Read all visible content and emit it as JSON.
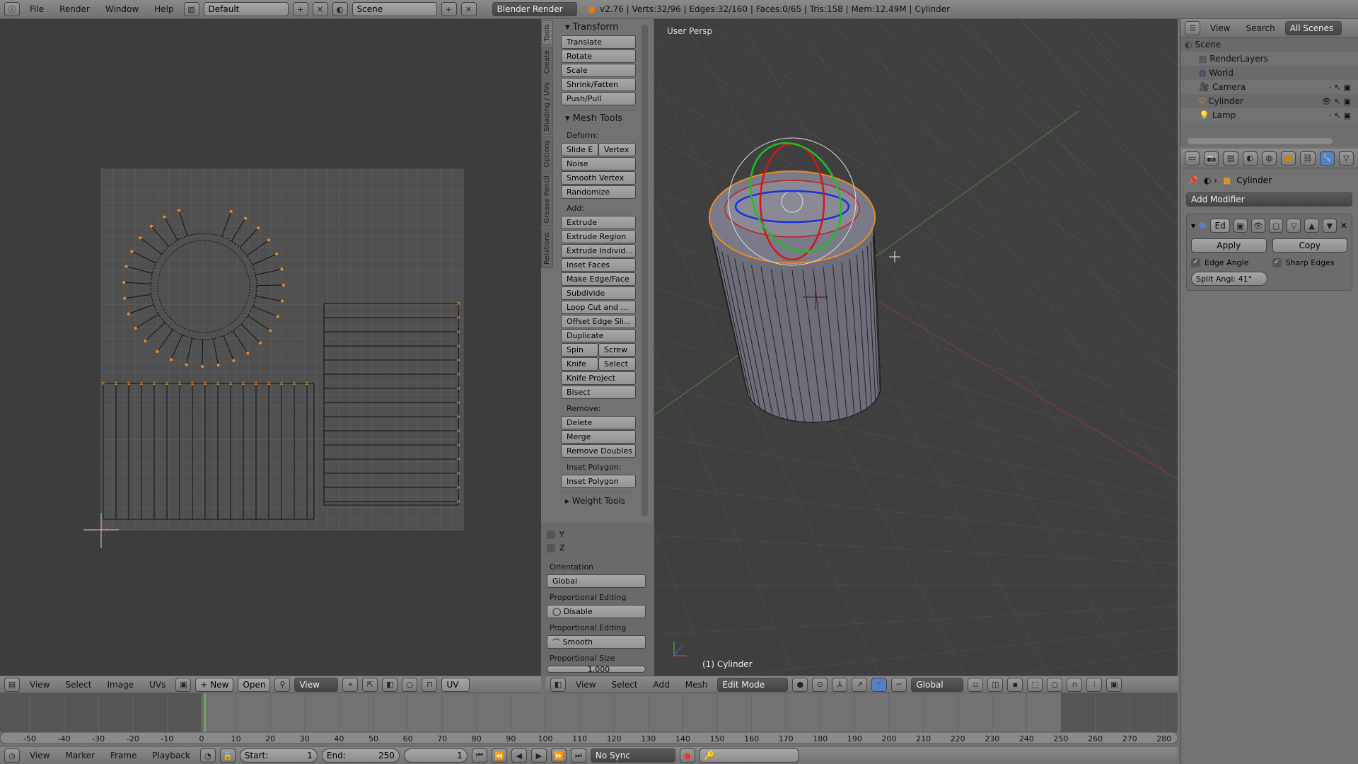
{
  "topbar": {
    "menus": [
      "File",
      "Render",
      "Window",
      "Help"
    ],
    "layout": "Default",
    "scene": "Scene",
    "engine": "Blender Render",
    "stats": "v2.76 | Verts:32/96 | Edges:32/160 | Faces:0/65 | Tris:158 | Mem:12.49M | Cylinder"
  },
  "uv_editor": {
    "header": {
      "menus": [
        "View",
        "Select",
        "Image",
        "UVs"
      ],
      "new": "New",
      "open": "Open",
      "view": "View",
      "uv": "UV"
    }
  },
  "toolshelf": {
    "tabs": [
      "Tools",
      "Create",
      "Shading / UVs",
      "Options",
      "Grease Pencil",
      "Relations"
    ],
    "transform": {
      "title": "Transform",
      "buttons": [
        "Translate",
        "Rotate",
        "Scale",
        "Shrink/Fatten",
        "Push/Pull"
      ]
    },
    "mesh_tools": {
      "title": "Mesh Tools",
      "deform_label": "Deform:",
      "slide": "Slide E",
      "vertex": "Vertex",
      "deform": [
        "Noise",
        "Smooth Vertex",
        "Randomize"
      ],
      "add_label": "Add:",
      "extrude": "Extrude",
      "add": [
        "Extrude Region",
        "Extrude Individ...",
        "Inset Faces",
        "Make Edge/Face",
        "Subdivide",
        "Loop Cut and ...",
        "Offset Edge Sli...",
        "Duplicate"
      ],
      "spin": "Spin",
      "screw": "Screw",
      "knife": "Knife",
      "select": "Select",
      "knife_project": "Knife Project",
      "bisect": "Bisect",
      "remove_label": "Remove:",
      "delete": "Delete",
      "merge": "Merge",
      "remove_doubles": "Remove Doubles",
      "inset_label": "Inset Polygon:",
      "inset": "Inset Polygon"
    },
    "weight_tools": "Weight Tools"
  },
  "operator": {
    "y": "Y",
    "z": "Z",
    "orientation_label": "Orientation",
    "orientation": "Global",
    "prop_label": "Proportional Editing",
    "prop": "Disable",
    "falloff_label": "Proportional Editing",
    "falloff": "Smooth",
    "size_label": "Proportional Size",
    "size": "1.000"
  },
  "viewport": {
    "title": "User Persp",
    "object": "(1) Cylinder",
    "header": {
      "menus": [
        "View",
        "Select",
        "Add",
        "Mesh"
      ],
      "mode": "Edit Mode",
      "orientation": "Global"
    }
  },
  "outliner": {
    "menus": [
      "View",
      "Search"
    ],
    "filter": "All Scenes",
    "items": [
      {
        "name": "Scene",
        "level": 0
      },
      {
        "name": "RenderLayers",
        "level": 1
      },
      {
        "name": "World",
        "level": 1
      },
      {
        "name": "Camera",
        "level": 1
      },
      {
        "name": "Cylinder",
        "level": 1
      },
      {
        "name": "Lamp",
        "level": 1
      }
    ]
  },
  "properties": {
    "breadcrumb": "Cylinder",
    "add_modifier": "Add Modifier",
    "modifier_name": "Ed",
    "apply": "Apply",
    "copy": "Copy",
    "edge_angle": "Edge Angle",
    "sharp_edges": "Sharp Edges",
    "split_angle": "Split Angl: 41°",
    "edge_angle_checked": true,
    "sharp_edges_checked": true
  },
  "timeline": {
    "ticks": [
      "-50",
      "-40",
      "-30",
      "-20",
      "-10",
      "0",
      "10",
      "20",
      "30",
      "40",
      "50",
      "60",
      "70",
      "80",
      "90",
      "100",
      "110",
      "120",
      "130",
      "140",
      "150",
      "160",
      "170",
      "180",
      "190",
      "200",
      "210",
      "220",
      "230",
      "240",
      "250",
      "260",
      "270",
      "280"
    ],
    "menus": [
      "View",
      "Marker",
      "Frame",
      "Playback"
    ],
    "start": "Start:",
    "start_val": "1",
    "end": "End:",
    "end_val": "250",
    "current": "1",
    "sync": "No Sync",
    "current_frame": 1,
    "frame_start": 1,
    "frame_end": 250
  },
  "colors": {
    "accent": "#5680c2",
    "selected": "#f08a24",
    "current_frame": "#60c040"
  }
}
